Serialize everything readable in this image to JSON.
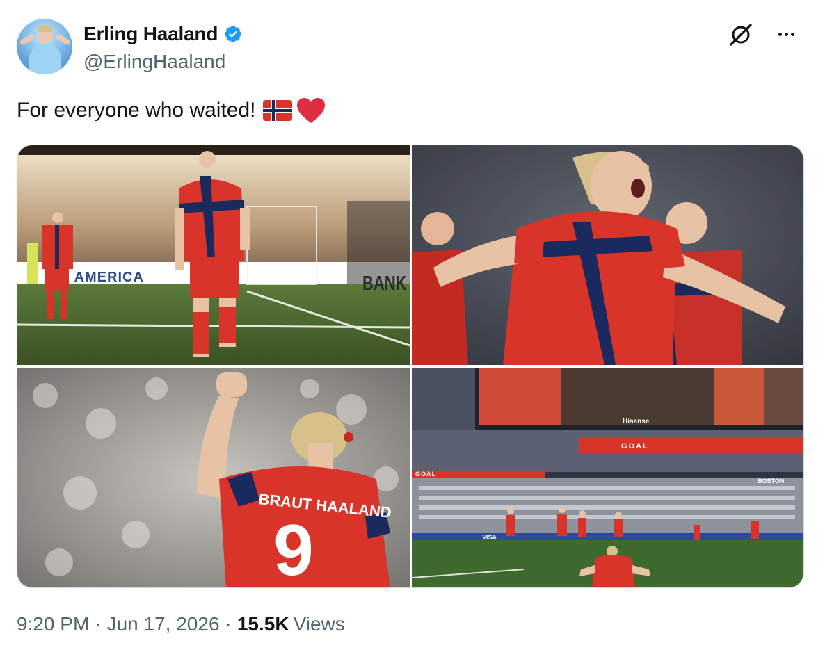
{
  "author": {
    "display_name": "Erling Haaland",
    "handle": "@ErlingHaaland",
    "verified": true,
    "avatar_icon": "avatar-photo"
  },
  "header_actions": {
    "grok_icon": "grok-icon",
    "more_icon": "more-options-icon"
  },
  "tweet": {
    "text": "For everyone who waited!",
    "emojis": [
      "norway-flag-emoji",
      "red-heart-emoji"
    ]
  },
  "media": {
    "photos": [
      {
        "id": "photo-1",
        "ad_board_left": "OF AMERICA",
        "ad_board_right": "BANK OF"
      },
      {
        "id": "photo-2"
      },
      {
        "id": "photo-3",
        "shirt_name": "BRAUT HAALAND",
        "shirt_number": "9"
      },
      {
        "id": "photo-4",
        "ribbon_left": "GOAL",
        "ribbon_right": "GOAL",
        "screen_sponsor": "Hisense",
        "board_sponsor": "VISA",
        "city_sign": "BOSTON"
      }
    ]
  },
  "meta": {
    "time": "9:20 PM",
    "date": "Jun 17, 2026",
    "separator": "·",
    "views_count": "15.5K",
    "views_label": "Views"
  },
  "colors": {
    "text_primary": "#0f1419",
    "text_secondary": "#536471",
    "verified_blue": "#1d9bf0",
    "border": "#cfd9de",
    "norway_red": "#d8342a",
    "norway_blue": "#1b2a5e"
  }
}
